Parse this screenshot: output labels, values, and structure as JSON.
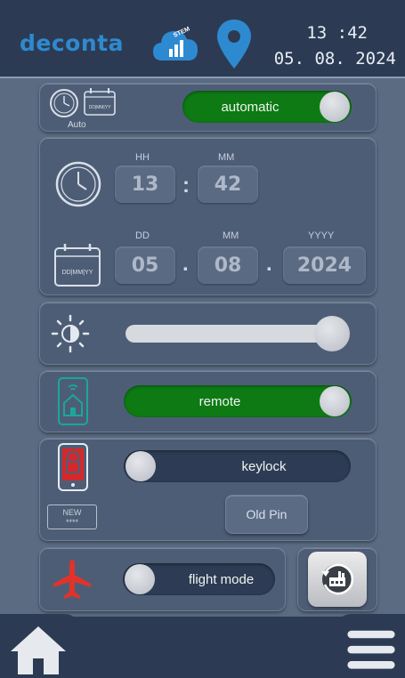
{
  "header": {
    "brand": "deconta",
    "cloud_icon_text": "STEM",
    "time": "13 :42",
    "date": "05. 08. 2024"
  },
  "auto_row": {
    "icon_label": "Auto",
    "toggle_label": "automatic",
    "toggle_on": true
  },
  "datetime": {
    "hh_label": "HH",
    "mm_label": "MM",
    "hour": "13",
    "minute": "42",
    "dd_label": "DD",
    "month_label": "MM",
    "yyyy_label": "YYYY",
    "day": "05",
    "month": "08",
    "year": "2024",
    "calendar_icon_text": "DD|MM|YY"
  },
  "brightness": {
    "level": 0.95
  },
  "remote": {
    "toggle_label": "remote",
    "toggle_on": true
  },
  "keylock": {
    "toggle_label": "keylock",
    "toggle_on": false,
    "new_pin_label": "NEW",
    "new_pin_stars": "****",
    "old_pin_button": "Old Pin"
  },
  "flight": {
    "toggle_label": "flight mode",
    "toggle_on": false
  },
  "colors": {
    "header_bg": "#2c3b53",
    "panel_bg": "#4e5d76",
    "accent_green": "#0d7a14",
    "brand_blue": "#2e8ad0",
    "lock_red": "#d5282c",
    "plane_red": "#e0332b",
    "teal_phone": "#1aa79b"
  },
  "icons": {
    "cloud": "cloud-signal-icon",
    "location": "location-pin-icon",
    "clock": "clock-icon",
    "calendar": "calendar-icon",
    "brightness": "brightness-icon",
    "remote": "remote-phone-icon",
    "lock": "lock-phone-icon",
    "plane": "airplane-icon",
    "factory": "factory-reset-icon",
    "home": "home-icon",
    "menu": "menu-icon"
  }
}
